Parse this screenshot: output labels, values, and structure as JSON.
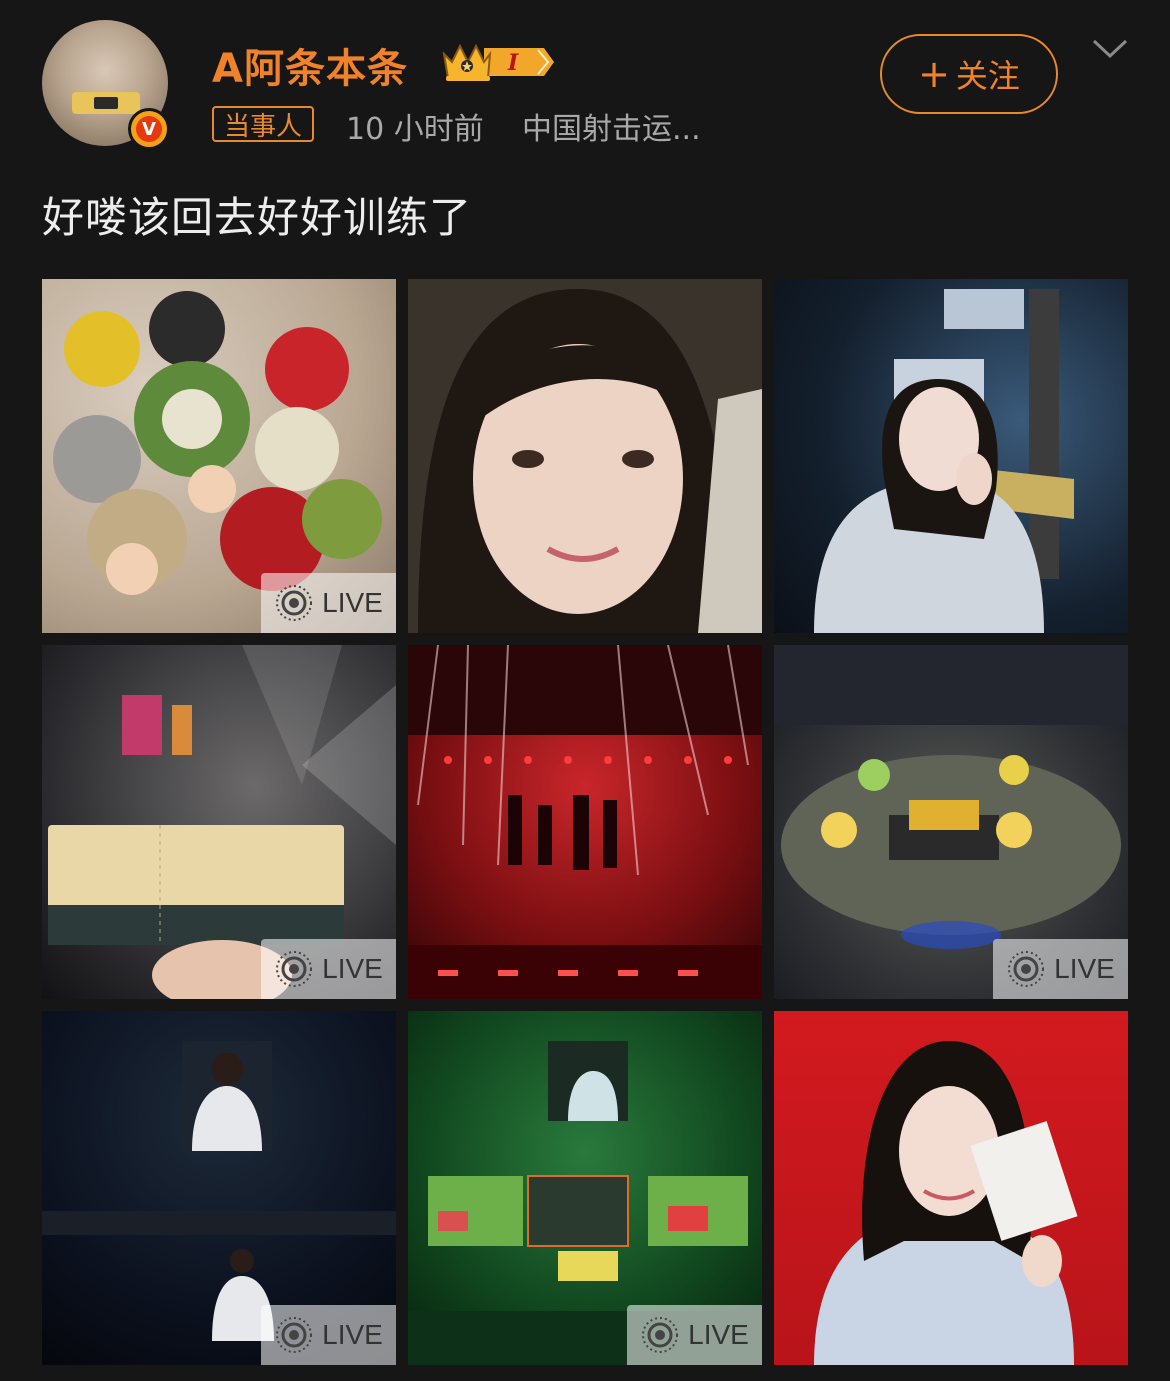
{
  "header": {
    "username": "A阿条本条",
    "level_badge": "I",
    "tag": "当事人",
    "time": "10 小时前",
    "source": "中国射击运...",
    "follow_label": "关注",
    "follow_plus": "+"
  },
  "post": {
    "text": "好喽该回去好好训练了"
  },
  "photos": [
    {
      "live": true,
      "live_label": "LIVE"
    },
    {
      "live": false
    },
    {
      "live": false
    },
    {
      "live": true,
      "live_label": "LIVE"
    },
    {
      "live": false
    },
    {
      "live": true,
      "live_label": "LIVE"
    },
    {
      "live": true,
      "live_label": "LIVE"
    },
    {
      "live": true,
      "live_label": "LIVE"
    },
    {
      "live": false
    }
  ],
  "verify_mark": "V",
  "colors": {
    "accent": "#f0822a",
    "background": "#161616",
    "meta_text": "#a9a9a9"
  },
  "icons": [
    "verify-icon",
    "crown-level-icon",
    "chevron-down-icon",
    "live-photo-icon"
  ]
}
